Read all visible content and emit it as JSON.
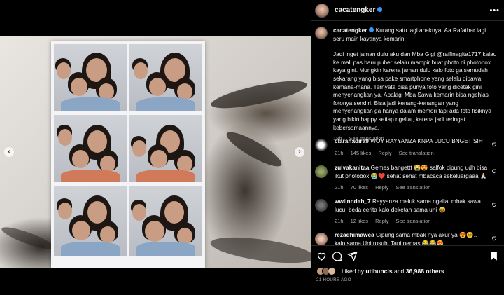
{
  "post": {
    "username": "cacatengker",
    "carousel_position": "3 of 6"
  },
  "caption": {
    "username": "cacatengker",
    "line1": "Kurang satu lagi anaknya, Aa Rafathar lagi seru main kayanya kemarin.",
    "line2": "Jadi inget jaman dulu aku dan Mba Gigi @raffinagita1717 kalau ke mall pas baru puber selalu mampir buat photo di photobox kaya gini. Mungkin karena jaman dulu kalo foto ga semudah sekarang yang bisa pake smartphone yang selalu dibawa kemana-mana. Ternyata bisa punya foto yang dicetak gini menyenangkan ya. Apalagi Mba Sawa kemarin bisa ngehias fotonya sendiri. Bisa jadi kenang-kenangan yang menyenangkan ga hanya dalam memori tapi ada foto fisiknya yang bikin happy setiap ngeliat, karena jadi teringat kebersamaannya.",
    "age": "18h",
    "see_translation": "See translation"
  },
  "comments": [
    {
      "user": "claranadira9",
      "text": "WOY RAYYANZA KNPA LUCU BNGET SIH",
      "age": "21h",
      "likes": "145 likes",
      "reply": "Reply",
      "translate": "See translation"
    },
    {
      "user": "zulvakanitaa",
      "text": "Gemes bangettt 😭😍 salfok cipung udh bisa ikut photobox 😭❤️ sehat sehat mbacaca sekeluargaaa 🙏🏻",
      "age": "21h",
      "likes": "70 likes",
      "reply": "Reply",
      "translate": "See translation"
    },
    {
      "user": "wwiinndah_7",
      "text": "Rayyanza meluk sama ngeliat mbak sawa lucu, beda cerita kalo deketan sama uni 😄",
      "age": "21h",
      "likes": "12 likes",
      "reply": "Reply",
      "translate": "See translation"
    },
    {
      "user": "rezadhimawea",
      "text": "Cipung sama mbak nya akur ya 😍😊.. kalo sama Uni rusuh. Tapi gemas 😂😂😍",
      "age": "",
      "likes": "",
      "reply": "",
      "translate": ""
    }
  ],
  "likes": {
    "prefix": "Liked by",
    "user": "utibuncis",
    "and": "and",
    "count": "36,988 others"
  },
  "timestamp": "21 HOURS AGO",
  "icons": [
    "verified-badge-icon",
    "more-options-icon",
    "heart-icon",
    "comment-icon",
    "share-icon",
    "bookmark-icon",
    "chevron-left-icon",
    "chevron-right-icon"
  ],
  "colors": {
    "background": "#000000",
    "accent": "#3897f0",
    "muted": "#a8a8a8"
  }
}
